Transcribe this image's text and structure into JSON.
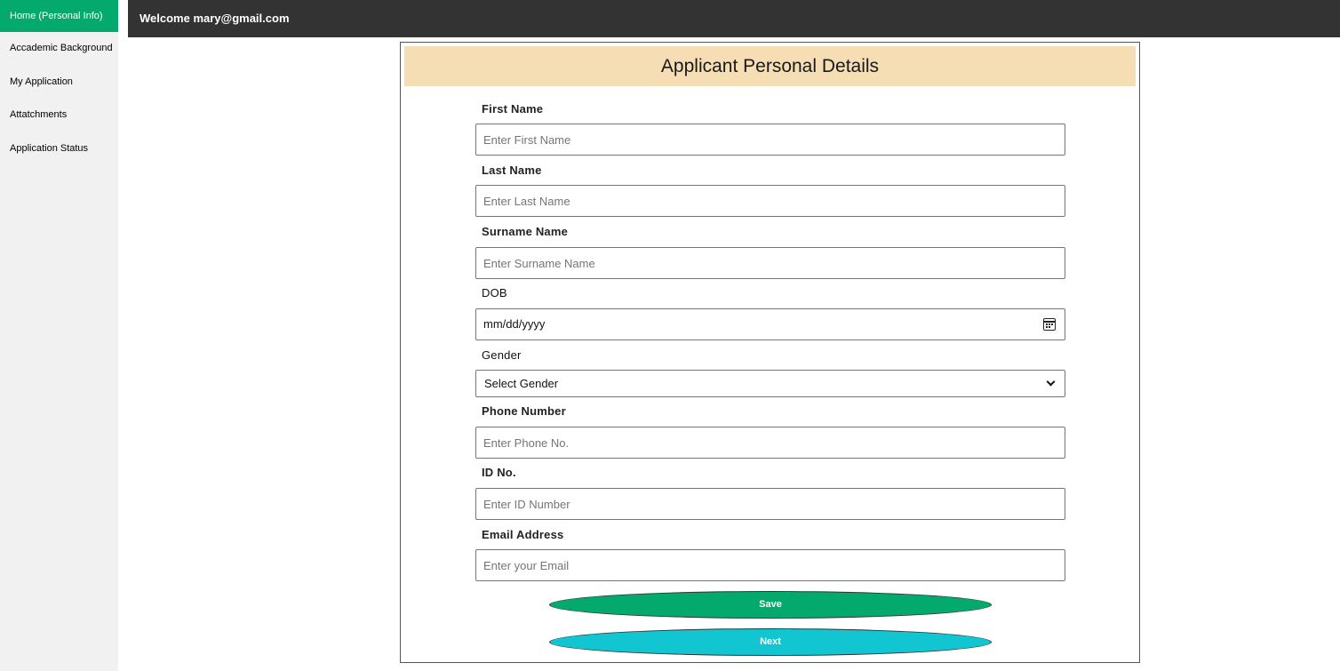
{
  "sidebar": {
    "items": [
      {
        "label": "Home (Personal Info)"
      },
      {
        "label": "Accademic Background"
      },
      {
        "label": "My Application"
      },
      {
        "label": "Attatchments"
      },
      {
        "label": "Application Status"
      }
    ]
  },
  "header": {
    "welcome": "Welcome mary@gmail.com"
  },
  "form": {
    "title": "Applicant Personal Details",
    "first_name": {
      "label": "First Name",
      "placeholder": "Enter First Name"
    },
    "last_name": {
      "label": "Last Name",
      "placeholder": "Enter Last Name"
    },
    "surname": {
      "label": "Surname Name",
      "placeholder": "Enter Surname Name"
    },
    "dob": {
      "label": "DOB",
      "value": "mm/dd/yyyy",
      "icon": "calendar-icon"
    },
    "gender": {
      "label": "Gender",
      "selected": "Select Gender",
      "icon": "chevron-down-icon"
    },
    "phone": {
      "label": "Phone Number",
      "placeholder": "Enter Phone No."
    },
    "id_no": {
      "label": "ID No.",
      "placeholder": "Enter ID Number"
    },
    "email": {
      "label": "Email Address",
      "placeholder": "Enter your Email"
    },
    "save_label": "Save",
    "next_label": "Next"
  },
  "colors": {
    "active_nav": "#04aa6d",
    "topbar": "#333333",
    "header_bg": "#f5deb3",
    "save_button": "#04aa6d",
    "next_button": "#11c6d0"
  }
}
